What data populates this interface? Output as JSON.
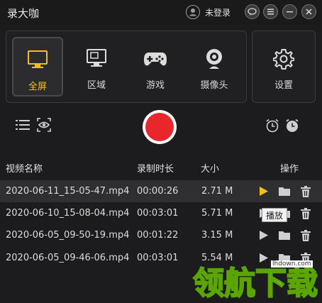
{
  "app": {
    "title": "录大咖",
    "login_text": "未登录"
  },
  "modes": [
    {
      "key": "fullscreen",
      "label": "全屏",
      "icon": "monitor-icon",
      "active": true
    },
    {
      "key": "region",
      "label": "区域",
      "icon": "region-monitor-icon",
      "active": false
    },
    {
      "key": "game",
      "label": "游戏",
      "icon": "gamepad-icon",
      "active": false
    },
    {
      "key": "camera",
      "label": "摄像头",
      "icon": "webcam-icon",
      "active": false
    }
  ],
  "settings": {
    "label": "设置",
    "icon": "gear-icon"
  },
  "table": {
    "headers": {
      "name": "视频名称",
      "duration": "录制时长",
      "size": "大小",
      "actions": "操作"
    },
    "rows": [
      {
        "name": "2020-06-11_15-05-47.mp4",
        "duration": "00:00:26",
        "size": "2.71 M",
        "selected": true
      },
      {
        "name": "2020-06-10_15-08-04.mp4",
        "duration": "00:03:01",
        "size": "5.71 M",
        "selected": false
      },
      {
        "name": "2020-06-05_09-50-19.mp4",
        "duration": "00:01:22",
        "size": "3.15 M",
        "selected": false
      },
      {
        "name": "2020-06-05_09-46-06.mp4",
        "duration": "00:03:01",
        "size": "5.54 M",
        "selected": false
      }
    ]
  },
  "tooltip": {
    "text": "播放"
  },
  "watermark": {
    "text": "领航下载",
    "url": "lhdown.com"
  },
  "colors": {
    "accent": "#f3c11c",
    "record": "#e8262b",
    "background": "#1c1c1e"
  }
}
